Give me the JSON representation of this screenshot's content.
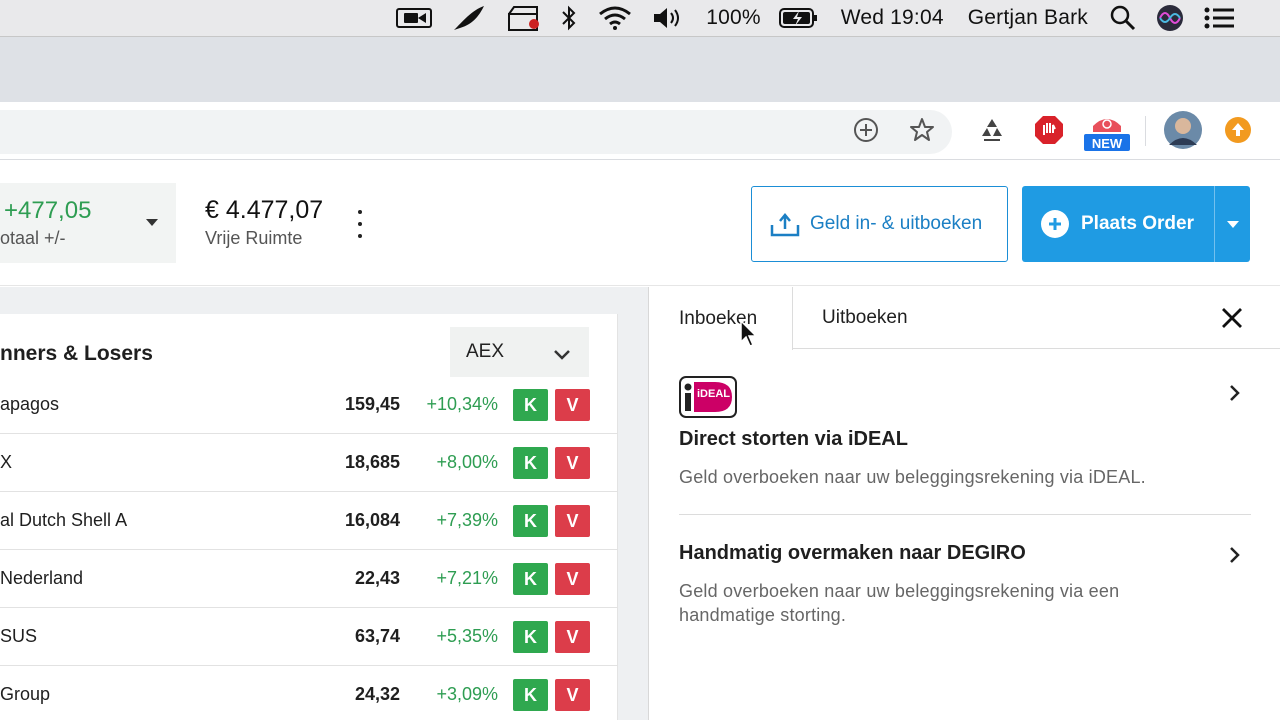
{
  "menubar": {
    "battery": "100%",
    "datetime": "Wed 19:04",
    "user": "Gertjan Bark"
  },
  "toolbar": {
    "extension_badge": "NEW"
  },
  "header": {
    "pl_value": "+477,05",
    "pl_label": "otaal +/-",
    "free_value": "€ 4.477,07",
    "free_label": "Vrije Ruimte",
    "geld_button": "Geld in- & uitboeken",
    "order_button": "Plaats Order"
  },
  "movers": {
    "title": "nners & Losers",
    "index": "AEX",
    "buy_label": "K",
    "sell_label": "V",
    "rows": [
      {
        "name": "apagos",
        "price": "159,45",
        "change": "+10,34%"
      },
      {
        "name": "X",
        "price": "18,685",
        "change": "+8,00%"
      },
      {
        "name": "al Dutch Shell A",
        "price": "16,084",
        "change": "+7,39%"
      },
      {
        "name": "Nederland",
        "price": "22,43",
        "change": "+7,21%"
      },
      {
        "name": "SUS",
        "price": "63,74",
        "change": "+5,35%"
      },
      {
        "name": "Group",
        "price": "24,32",
        "change": "+3,09%"
      }
    ]
  },
  "panel": {
    "tab_in": "Inboeken",
    "tab_out": "Uitboeken",
    "options": [
      {
        "logo": "iDEAL",
        "title": "Direct storten via iDEAL",
        "desc": "Geld overboeken naar uw beleggingsrekening via iDEAL."
      },
      {
        "title": "Handmatig overmaken naar DEGIRO",
        "desc": "Geld overboeken naar uw beleggingsrekening via een handmatige storting."
      }
    ]
  },
  "colors": {
    "positive": "#2e9d52",
    "buy": "#2fa84f",
    "sell": "#dc3d4a",
    "primary": "#1f9be3"
  }
}
